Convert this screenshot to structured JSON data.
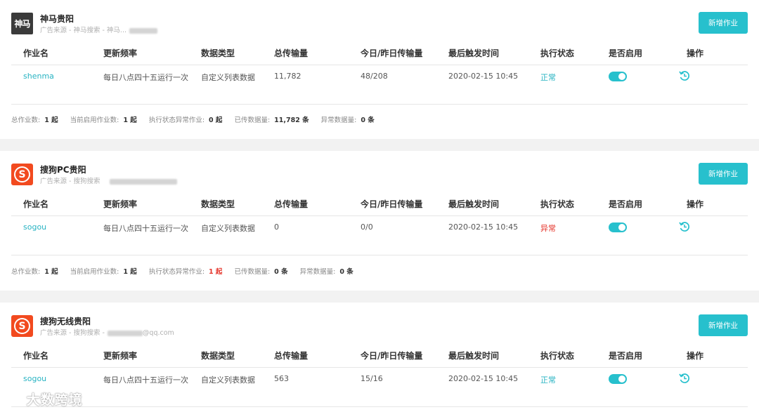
{
  "add_label": "新增作业",
  "columns": [
    "作业名",
    "更新频率",
    "数据类型",
    "总传输量",
    "今日/昨日传输量",
    "最后触发时间",
    "执行状态",
    "是否启用",
    "操作"
  ],
  "summary_labels": {
    "total": "总作业数:",
    "enabled": "当前启用作业数:",
    "abnormal": "执行状态异常作业:",
    "transferred": "已传数据量:",
    "error_data": "异常数据量:"
  },
  "panels": [
    {
      "logo_text": "神马",
      "title": "神马贵阳",
      "source": "广告来源 - 神马搜索 - 神马...",
      "row": {
        "name": "shenma",
        "frequency": "每日八点四十五运行一次",
        "data_type": "自定义列表数据",
        "total": "11,782",
        "today_yesterday": "48/208",
        "last_trigger": "2020-02-15 10:45",
        "status": "正常",
        "status_kind": "ok",
        "enabled": true
      },
      "summary": {
        "total": "1 起",
        "enabled": "1 起",
        "abnormal": "0 起",
        "transferred": "11,782 条",
        "error_data": "0 条"
      }
    },
    {
      "logo_text": "S",
      "title": "搜狗PC贵阳",
      "source": "广告来源 - 搜狗搜索",
      "row": {
        "name": "sogou",
        "frequency": "每日八点四十五运行一次",
        "data_type": "自定义列表数据",
        "total": "0",
        "today_yesterday": "0/0",
        "last_trigger": "2020-02-15 10:45",
        "status": "异常",
        "status_kind": "error",
        "enabled": true
      },
      "summary": {
        "total": "1 起",
        "enabled": "1 起",
        "abnormal": "1 起",
        "transferred": "0 条",
        "error_data": "0 条"
      }
    },
    {
      "logo_text": "S",
      "title": "搜狗无线贵阳",
      "source": "广告来源 - 搜狗搜索 -",
      "source_suffix": "@qq.com",
      "row": {
        "name": "sogou",
        "frequency": "每日八点四十五运行一次",
        "data_type": "自定义列表数据",
        "total": "563",
        "today_yesterday": "15/16",
        "last_trigger": "2020-02-15 10:45",
        "status": "正常",
        "status_kind": "ok",
        "enabled": true
      }
    }
  ],
  "watermark": "大数跨境",
  "colors": {
    "accent": "#27c0cd",
    "error": "#e5362c",
    "sogou": "#f24a1f"
  }
}
